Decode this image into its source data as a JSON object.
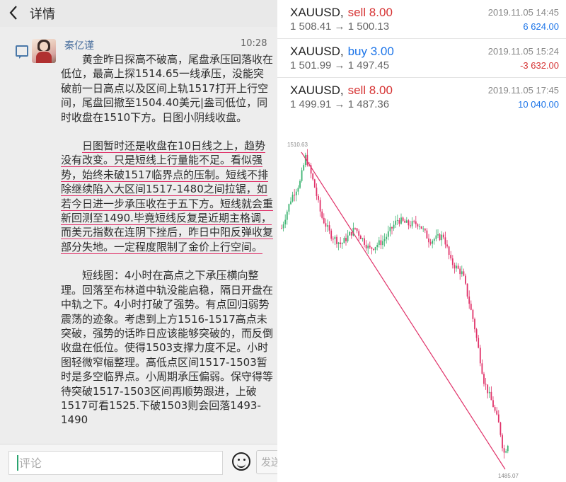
{
  "header": {
    "title": "详情"
  },
  "post": {
    "username": "秦亿谨",
    "time": "10:28",
    "paragraphs": [
      "黄金昨日探高不破高，尾盘承压回落收在低位，最高上探1514.65一线承压，没能突破前一日高点以及区间上轨1517打开上行空间，尾盘回撤至1504.40美元|盎司低位，同时收盘在1510下方。日图小阴线收盘。",
      "日图暂时还是收盘在10日线之上，趋势没有改变。只是短线上行量能不足。看似强势，始终未破1517临界点的压制。短线不排除继续陷入大区间1517-1480之间拉锯，如若今日进一步承压收在于五下方。短线就会重新回测至1490.毕竟短线反复是近期主格调，而美元指数在连阴下挫后，昨日中阳反弹收复部分失地。一定程度限制了金价上行空间。",
      "短线图：4小时在高点之下承压横向整理。回落至布林道中轨没能启稳，隔日开盘在中轨之下。4小时打破了强势。有点回归弱势震荡的迹象。考虑到上方1516-1517高点未突破，强势的话昨日应该能够突破的，而反倒收盘在低位。使得1503支撑力度不足。小时图轻微窄幅整理。高低点区间1517-1503暂时是多空临界点。小周期承压偏弱。保守得等待突破1517-1503区间再顺势跟进，上破1517可看1525.下破1503则会回落1493-1490"
    ]
  },
  "comment": {
    "placeholder": "评论",
    "send_label": "发送"
  },
  "orders": [
    {
      "symbol": "XAUUSD,",
      "type": "sell 8.00",
      "side": "sell",
      "price": "1 508.41 → 1 500.13",
      "date": "2019.11.05 14:45",
      "profit": "6 624.00",
      "profit_color": "#1a73e8"
    },
    {
      "symbol": "XAUUSD,",
      "type": "buy 3.00",
      "side": "buy",
      "price": "1 501.99 → 1 497.45",
      "date": "2019.11.05 15:24",
      "profit": "-3 632.00",
      "profit_color": "#d63333"
    },
    {
      "symbol": "XAUUSD,",
      "type": "sell 8.00",
      "side": "sell",
      "price": "1 499.91 → 1 487.36",
      "date": "2019.11.05 17:45",
      "profit": "10 040.00",
      "profit_color": "#1a73e8"
    }
  ],
  "chart": {
    "high_label": "1510.63",
    "low_label": "1485.07",
    "high_value": 1510.63,
    "low_value": 1485.07,
    "up_color": "#3cb371",
    "down_color": "#e0336a",
    "line_color": "#e0336a"
  }
}
